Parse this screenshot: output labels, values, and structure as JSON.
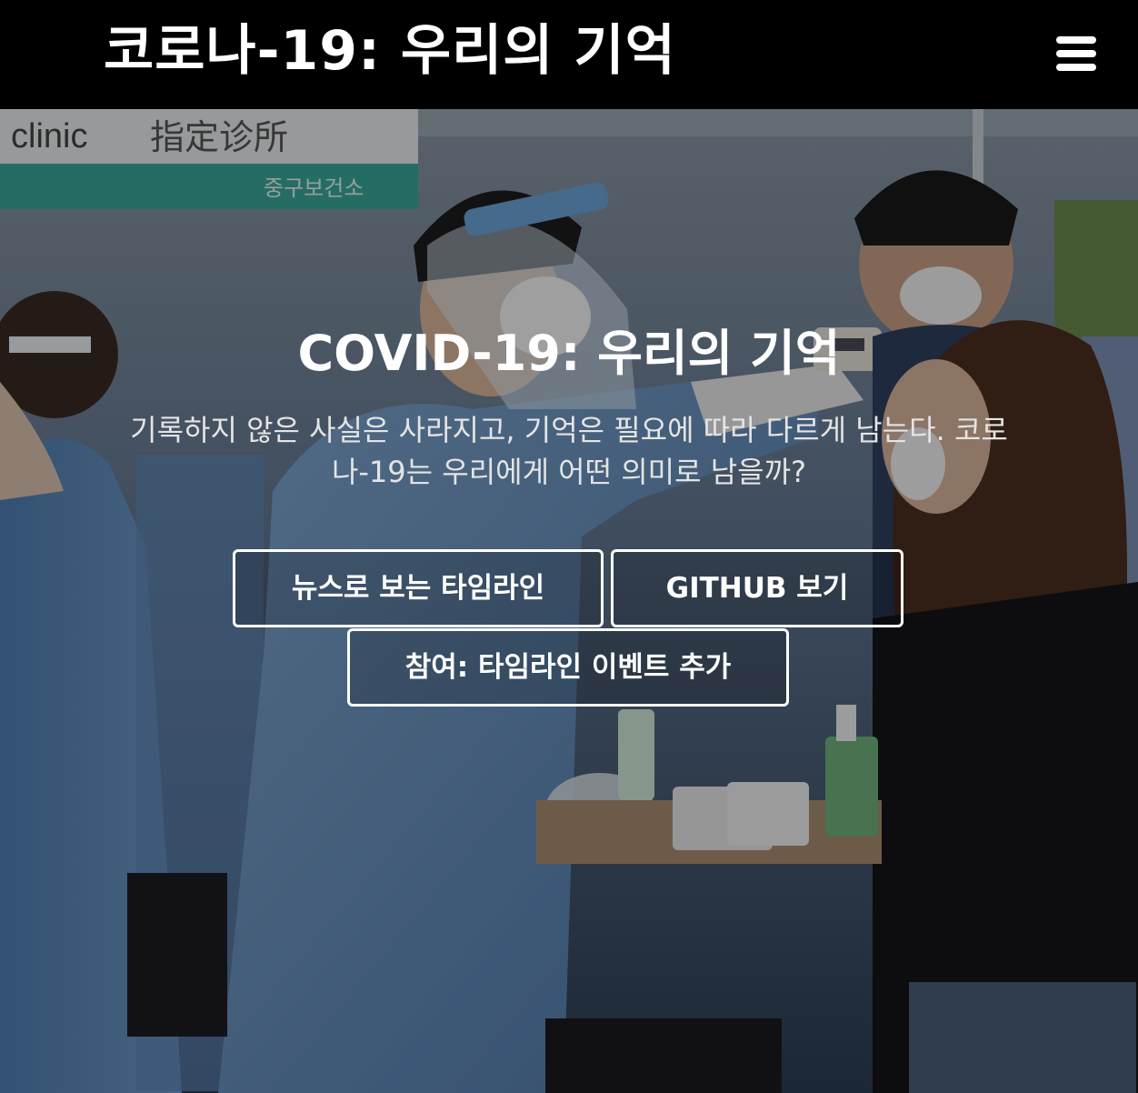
{
  "navbar": {
    "brand": "코로나-19: 우리의 기억",
    "menu_icon": "hamburger-menu-icon"
  },
  "hero": {
    "title": "COVID-19: 우리의 기억",
    "description": "기록하지 않은 사실은 사라지고, 기억은 필요에 따라 다르게 남는다. 코로나-19는 우리에게 어떤 의미로 남을까?",
    "buttons": {
      "timeline": "뉴스로 보는 타임라인",
      "github": "GITHUB 보기",
      "join": "참여: 타임라인 이벤트 추가"
    },
    "photo_signs": {
      "clinic": "clinic",
      "chinese": "指定诊所",
      "district": "중구보건소"
    }
  },
  "colors": {
    "navbar_bg": "#000000",
    "text": "#ffffff",
    "photo_blue": "#3d5f86"
  }
}
